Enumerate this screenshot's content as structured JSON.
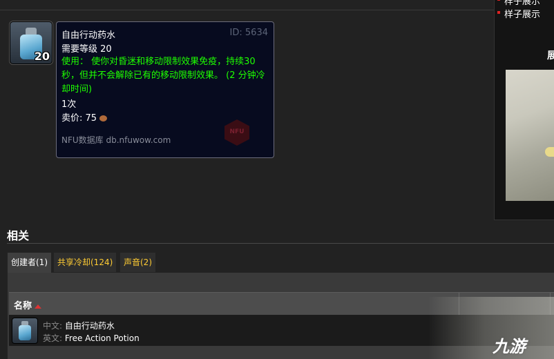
{
  "sidebar": {
    "links": [
      "样子展示",
      "样子展示"
    ],
    "heading": "展"
  },
  "item": {
    "stack_count": "20",
    "icon": "potion-bottle-icon"
  },
  "tooltip": {
    "name": "自由行动药水",
    "id": "ID: 5634",
    "level": "需要等级 20",
    "use": "使用： 使你对昏迷和移动限制效果免疫，持续30 秒，但并不会解除已有的移动限制效果。 (2 分钟冷却时间)",
    "count": "1次",
    "sell_label": "卖价:",
    "sell_value": "75",
    "source": "NFU数据库 db.nfuwow.com",
    "logo": "NFU"
  },
  "related": {
    "title": "相关",
    "tabs": [
      {
        "label": "创建者(1)",
        "active": true
      },
      {
        "label": "共享冷却(124)",
        "active": false
      },
      {
        "label": "声音(2)",
        "active": false
      }
    ],
    "table": {
      "header_name": "名称",
      "rows": [
        {
          "cn_label": "中文:",
          "cn_value": "自由行动药水",
          "en_label": "英文:",
          "en_value": "Free Action Potion"
        }
      ]
    }
  },
  "watermark": "九游",
  "colors": {
    "tooltip_green": "#1eff00",
    "tab_gold": "#ffcc33"
  }
}
